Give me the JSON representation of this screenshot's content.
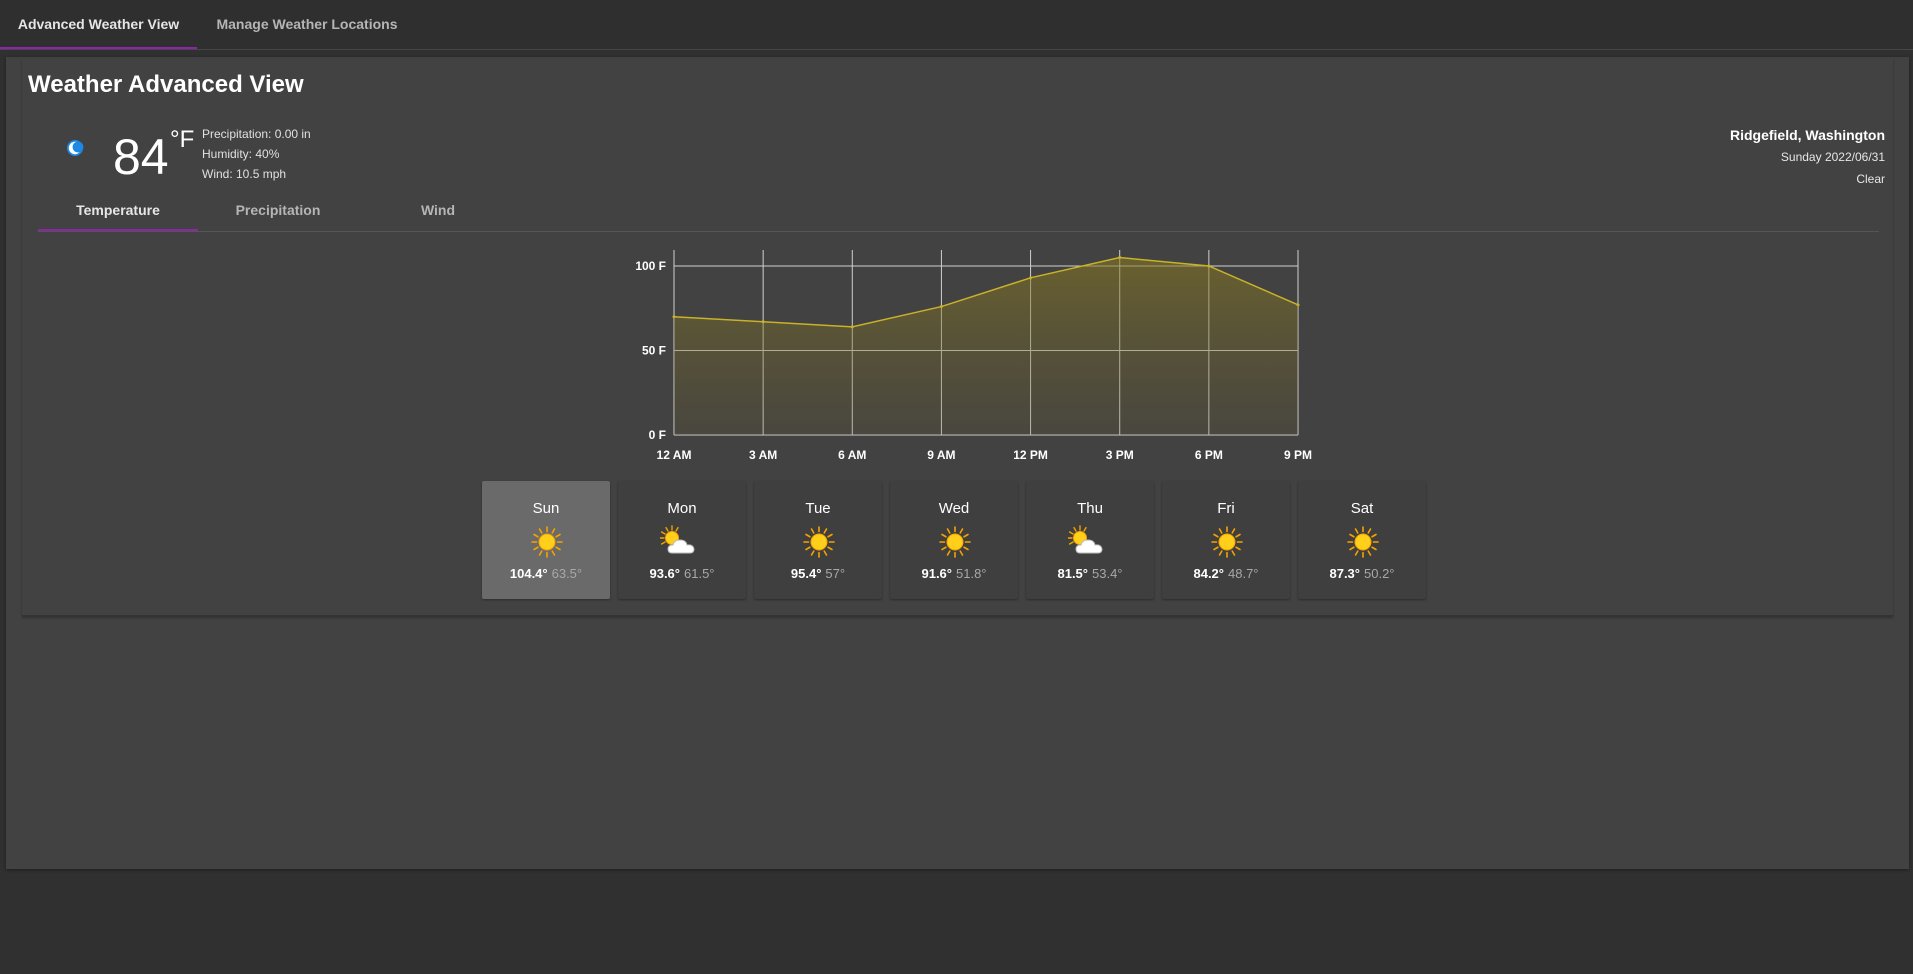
{
  "tabs": [
    "Advanced Weather View",
    "Manage Weather Locations"
  ],
  "title": "Weather Advanced View",
  "current": {
    "icon": "moon-icon",
    "temperature": "84",
    "unit": "°F",
    "precipitation": "Precipitation: 0.00 in",
    "humidity": "Humidity: 40%",
    "wind": "Wind: 10.5 mph"
  },
  "location": {
    "city": "Ridgefield, Washington",
    "date": "Sunday 2022/06/31",
    "condition": "Clear"
  },
  "subtabs": [
    "Temperature",
    "Precipitation",
    "Wind"
  ],
  "colors": {
    "accent": "#8e24aa",
    "line": "#c9b12a",
    "panel": "#424242",
    "selected_day": "#6a6a6a"
  },
  "chart_data": {
    "type": "area",
    "x": [
      "12 AM",
      "3 AM",
      "6 AM",
      "9 AM",
      "12 PM",
      "3 PM",
      "6 PM",
      "9 PM"
    ],
    "series": [
      {
        "values": [
          70,
          67,
          64,
          76,
          93,
          105,
          100,
          77
        ]
      }
    ],
    "yticks": [
      "0 F",
      "50 F",
      "100 F"
    ],
    "ylim": [
      0,
      100
    ],
    "grid": true
  },
  "days": [
    {
      "name": "Sun",
      "icon": "sun-icon",
      "high": "104.4°",
      "low": "63.5°",
      "selected": true
    },
    {
      "name": "Mon",
      "icon": "partly-cloudy-icon",
      "high": "93.6°",
      "low": "61.5°",
      "selected": false
    },
    {
      "name": "Tue",
      "icon": "sun-icon",
      "high": "95.4°",
      "low": "57°",
      "selected": false
    },
    {
      "name": "Wed",
      "icon": "sun-icon",
      "high": "91.6°",
      "low": "51.8°",
      "selected": false
    },
    {
      "name": "Thu",
      "icon": "partly-cloudy-icon",
      "high": "81.5°",
      "low": "53.4°",
      "selected": false
    },
    {
      "name": "Fri",
      "icon": "sun-icon",
      "high": "84.2°",
      "low": "48.7°",
      "selected": false
    },
    {
      "name": "Sat",
      "icon": "sun-icon",
      "high": "87.3°",
      "low": "50.2°",
      "selected": false
    }
  ]
}
